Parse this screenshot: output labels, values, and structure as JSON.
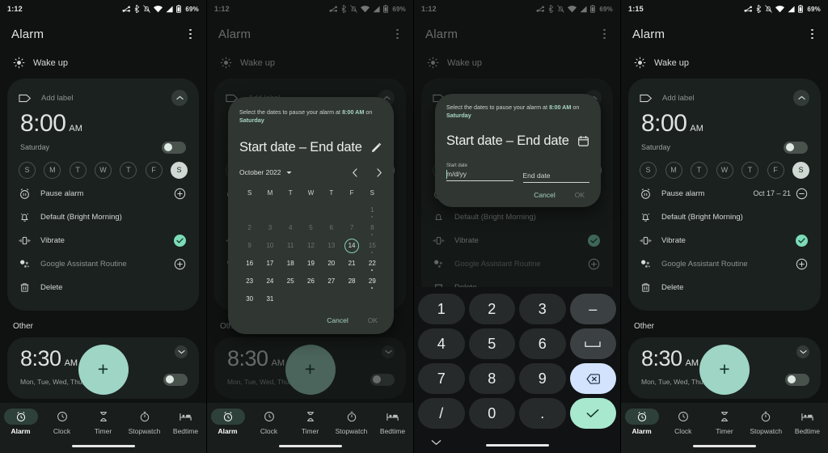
{
  "panels": [
    {
      "status": {
        "time": "1:12",
        "battery": "69%"
      },
      "appbar": {
        "title": "Alarm",
        "menu": "overflow-menu"
      },
      "group": {
        "label": "Wake up"
      },
      "alarm": {
        "add_label": "Add label",
        "time": "8:00",
        "ampm": "AM",
        "day_summary": "Saturday",
        "dows": [
          "S",
          "M",
          "T",
          "W",
          "T",
          "F",
          "S"
        ],
        "selected_dow_index": 6,
        "options": [
          {
            "label": "Pause alarm",
            "value": "",
            "trailing": "plus"
          },
          {
            "label": "Default (Bright Morning)",
            "value": "",
            "trailing": "none"
          },
          {
            "label": "Vibrate",
            "value": "",
            "trailing": "check"
          },
          {
            "label": "Google Assistant Routine",
            "value": "",
            "trailing": "plus"
          },
          {
            "label": "Delete",
            "value": "",
            "trailing": "none"
          }
        ]
      },
      "other": {
        "title": "Other",
        "time": "8:30",
        "ampm": "AM",
        "days": "Mon, Tue, Wed, Thu, Fri"
      },
      "fab": {
        "label": "+"
      },
      "nav": [
        {
          "label": "Alarm",
          "icon": "alarm-icon",
          "active": true
        },
        {
          "label": "Clock",
          "icon": "clock-icon",
          "active": false
        },
        {
          "label": "Timer",
          "icon": "hourglass-icon",
          "active": false
        },
        {
          "label": "Stopwatch",
          "icon": "stopwatch-icon",
          "active": false
        },
        {
          "label": "Bedtime",
          "icon": "bed-icon",
          "active": false
        }
      ]
    },
    {
      "status": {
        "time": "1:12",
        "battery": "69%"
      },
      "dialog": {
        "headline": "Select the dates to pause your alarm at ",
        "headline_bold_time": "8:00 AM",
        "headline_mid": " on ",
        "headline_bold_day": "Saturday",
        "title": "Start date – End date",
        "title_icon": "pencil-icon",
        "month": "October 2022",
        "month_caret": "caret-down-icon",
        "prev": "chevron-left-icon",
        "next": "chevron-right-icon",
        "weekdays": [
          "S",
          "M",
          "T",
          "W",
          "T",
          "F",
          "S"
        ],
        "weeks": [
          [
            null,
            null,
            null,
            null,
            null,
            null,
            1
          ],
          [
            2,
            3,
            4,
            5,
            6,
            7,
            8
          ],
          [
            9,
            10,
            11,
            12,
            13,
            14,
            15
          ],
          [
            16,
            17,
            18,
            19,
            20,
            21,
            22
          ],
          [
            23,
            24,
            25,
            26,
            27,
            28,
            29
          ],
          [
            30,
            31,
            null,
            null,
            null,
            null,
            null
          ]
        ],
        "today": 14,
        "dotted_days": [
          1,
          8,
          15,
          22,
          29
        ],
        "past_until": 15,
        "cancel": "Cancel",
        "ok": "OK"
      }
    },
    {
      "status": {
        "time": "1:12",
        "battery": "69%"
      },
      "dialog": {
        "headline": "Select the dates to pause your alarm at ",
        "headline_bold_time": "8:00 AM",
        "headline_mid": " on ",
        "headline_bold_day": "Saturday",
        "title": "Start date – End date",
        "title_icon": "calendar-icon",
        "start_label": "Start date",
        "start_placeholder": "m/d/yy",
        "end_placeholder": "End date",
        "cancel": "Cancel",
        "ok": "OK"
      },
      "keyboard": {
        "rows": [
          [
            {
              "label": "1",
              "kind": "num"
            },
            {
              "label": "2",
              "kind": "num"
            },
            {
              "label": "3",
              "kind": "num"
            },
            {
              "label": "–",
              "kind": "fn"
            }
          ],
          [
            {
              "label": "4",
              "kind": "num"
            },
            {
              "label": "5",
              "kind": "num"
            },
            {
              "label": "6",
              "kind": "num"
            },
            {
              "label": "␣",
              "kind": "fn"
            }
          ],
          [
            {
              "label": "7",
              "kind": "num"
            },
            {
              "label": "8",
              "kind": "num"
            },
            {
              "label": "9",
              "kind": "num"
            },
            {
              "label": "",
              "kind": "del"
            }
          ],
          [
            {
              "label": "/",
              "kind": "num"
            },
            {
              "label": "0",
              "kind": "num"
            },
            {
              "label": ".",
              "kind": "num"
            },
            {
              "label": "",
              "kind": "ok"
            }
          ]
        ],
        "dismiss_icon": "chevron-down-icon"
      }
    },
    {
      "status": {
        "time": "1:15",
        "battery": "69%"
      },
      "appbar": {
        "title": "Alarm",
        "menu": "overflow-menu"
      },
      "group": {
        "label": "Wake up"
      },
      "alarm": {
        "add_label": "Add label",
        "time": "8:00",
        "ampm": "AM",
        "day_summary": "Saturday",
        "dows": [
          "S",
          "M",
          "T",
          "W",
          "T",
          "F",
          "S"
        ],
        "selected_dow_index": 6,
        "options": [
          {
            "label": "Pause alarm",
            "value": "Oct 17 – 21",
            "trailing": "minus"
          },
          {
            "label": "Default (Bright Morning)",
            "value": "",
            "trailing": "none"
          },
          {
            "label": "Vibrate",
            "value": "",
            "trailing": "check"
          },
          {
            "label": "Google Assistant Routine",
            "value": "",
            "trailing": "plus"
          },
          {
            "label": "Delete",
            "value": "",
            "trailing": "none"
          }
        ]
      },
      "other": {
        "title": "Other",
        "time": "8:30",
        "ampm": "AM",
        "days": "Mon, Tue, Wed, Thu, Fri"
      },
      "fab": {
        "label": "+"
      },
      "nav": [
        {
          "label": "Alarm",
          "icon": "alarm-icon",
          "active": true
        },
        {
          "label": "Clock",
          "icon": "clock-icon",
          "active": false
        },
        {
          "label": "Timer",
          "icon": "hourglass-icon",
          "active": false
        },
        {
          "label": "Stopwatch",
          "icon": "stopwatch-icon",
          "active": false
        },
        {
          "label": "Bedtime",
          "icon": "bed-icon",
          "active": false
        }
      ]
    }
  ],
  "colors": {
    "accent_mint": "#9ed5c5",
    "card_bg": "#1b211f",
    "screen_bg": "#0f1211",
    "dialog_bg": "#303733",
    "key_del": "#d3e3fd",
    "key_ok": "#a7e8cf",
    "check_green": "#7ddbb8"
  }
}
